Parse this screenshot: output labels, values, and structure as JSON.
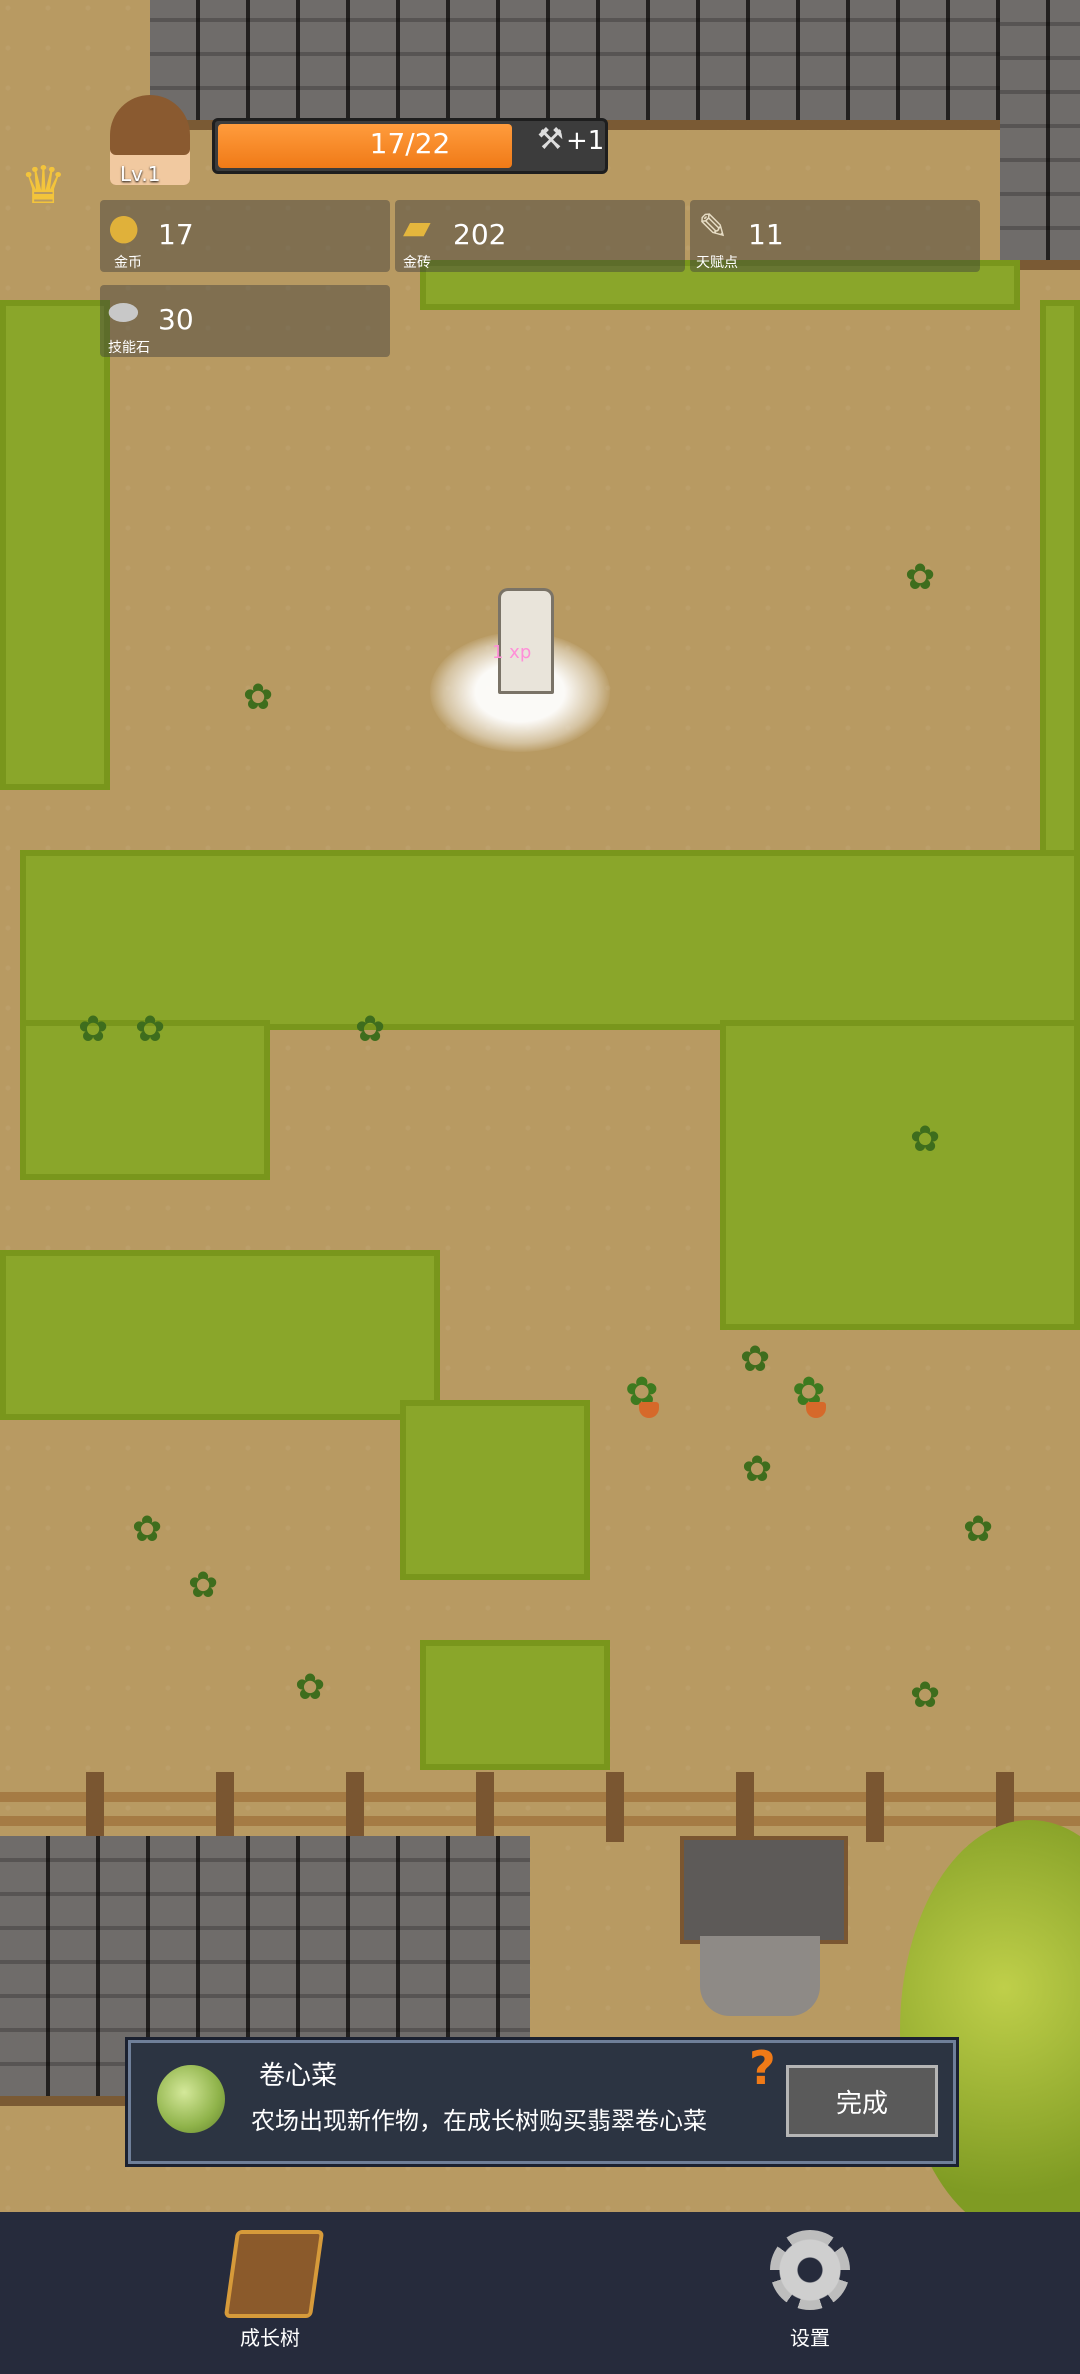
{
  "hud": {
    "level": "Lv.1",
    "hp_text": "17/22",
    "hp_fraction": 0.77,
    "tool_bonus": "+1",
    "resources": [
      {
        "icon": "gold-coin-icon",
        "value": "17",
        "label": "金币"
      },
      {
        "icon": "gold-bar-icon",
        "value": "202",
        "label": "金砖"
      },
      {
        "icon": "talent-scroll-icon",
        "value": "11",
        "label": "天赋点"
      },
      {
        "icon": "skill-stone-icon",
        "value": "30",
        "label": "技能石"
      }
    ]
  },
  "scene": {
    "xp_popup": "1 xp"
  },
  "notification": {
    "icon": "cabbage-icon",
    "title": "卷心菜",
    "description": "农场出现新作物，在成长树购买翡翠卷心菜",
    "help_icon": "question-icon",
    "done_label": "完成"
  },
  "bottom_nav": {
    "growth_tree": {
      "icon": "book-icon",
      "label": "成长树"
    },
    "settings": {
      "icon": "gear-icon",
      "label": "设置"
    }
  },
  "colors": {
    "hp_bar": "#f07a17",
    "grass": "#8aa62a",
    "dirt": "#b89a62",
    "nav_bg": "#262b3c",
    "notice_bg": "#2c3442"
  }
}
